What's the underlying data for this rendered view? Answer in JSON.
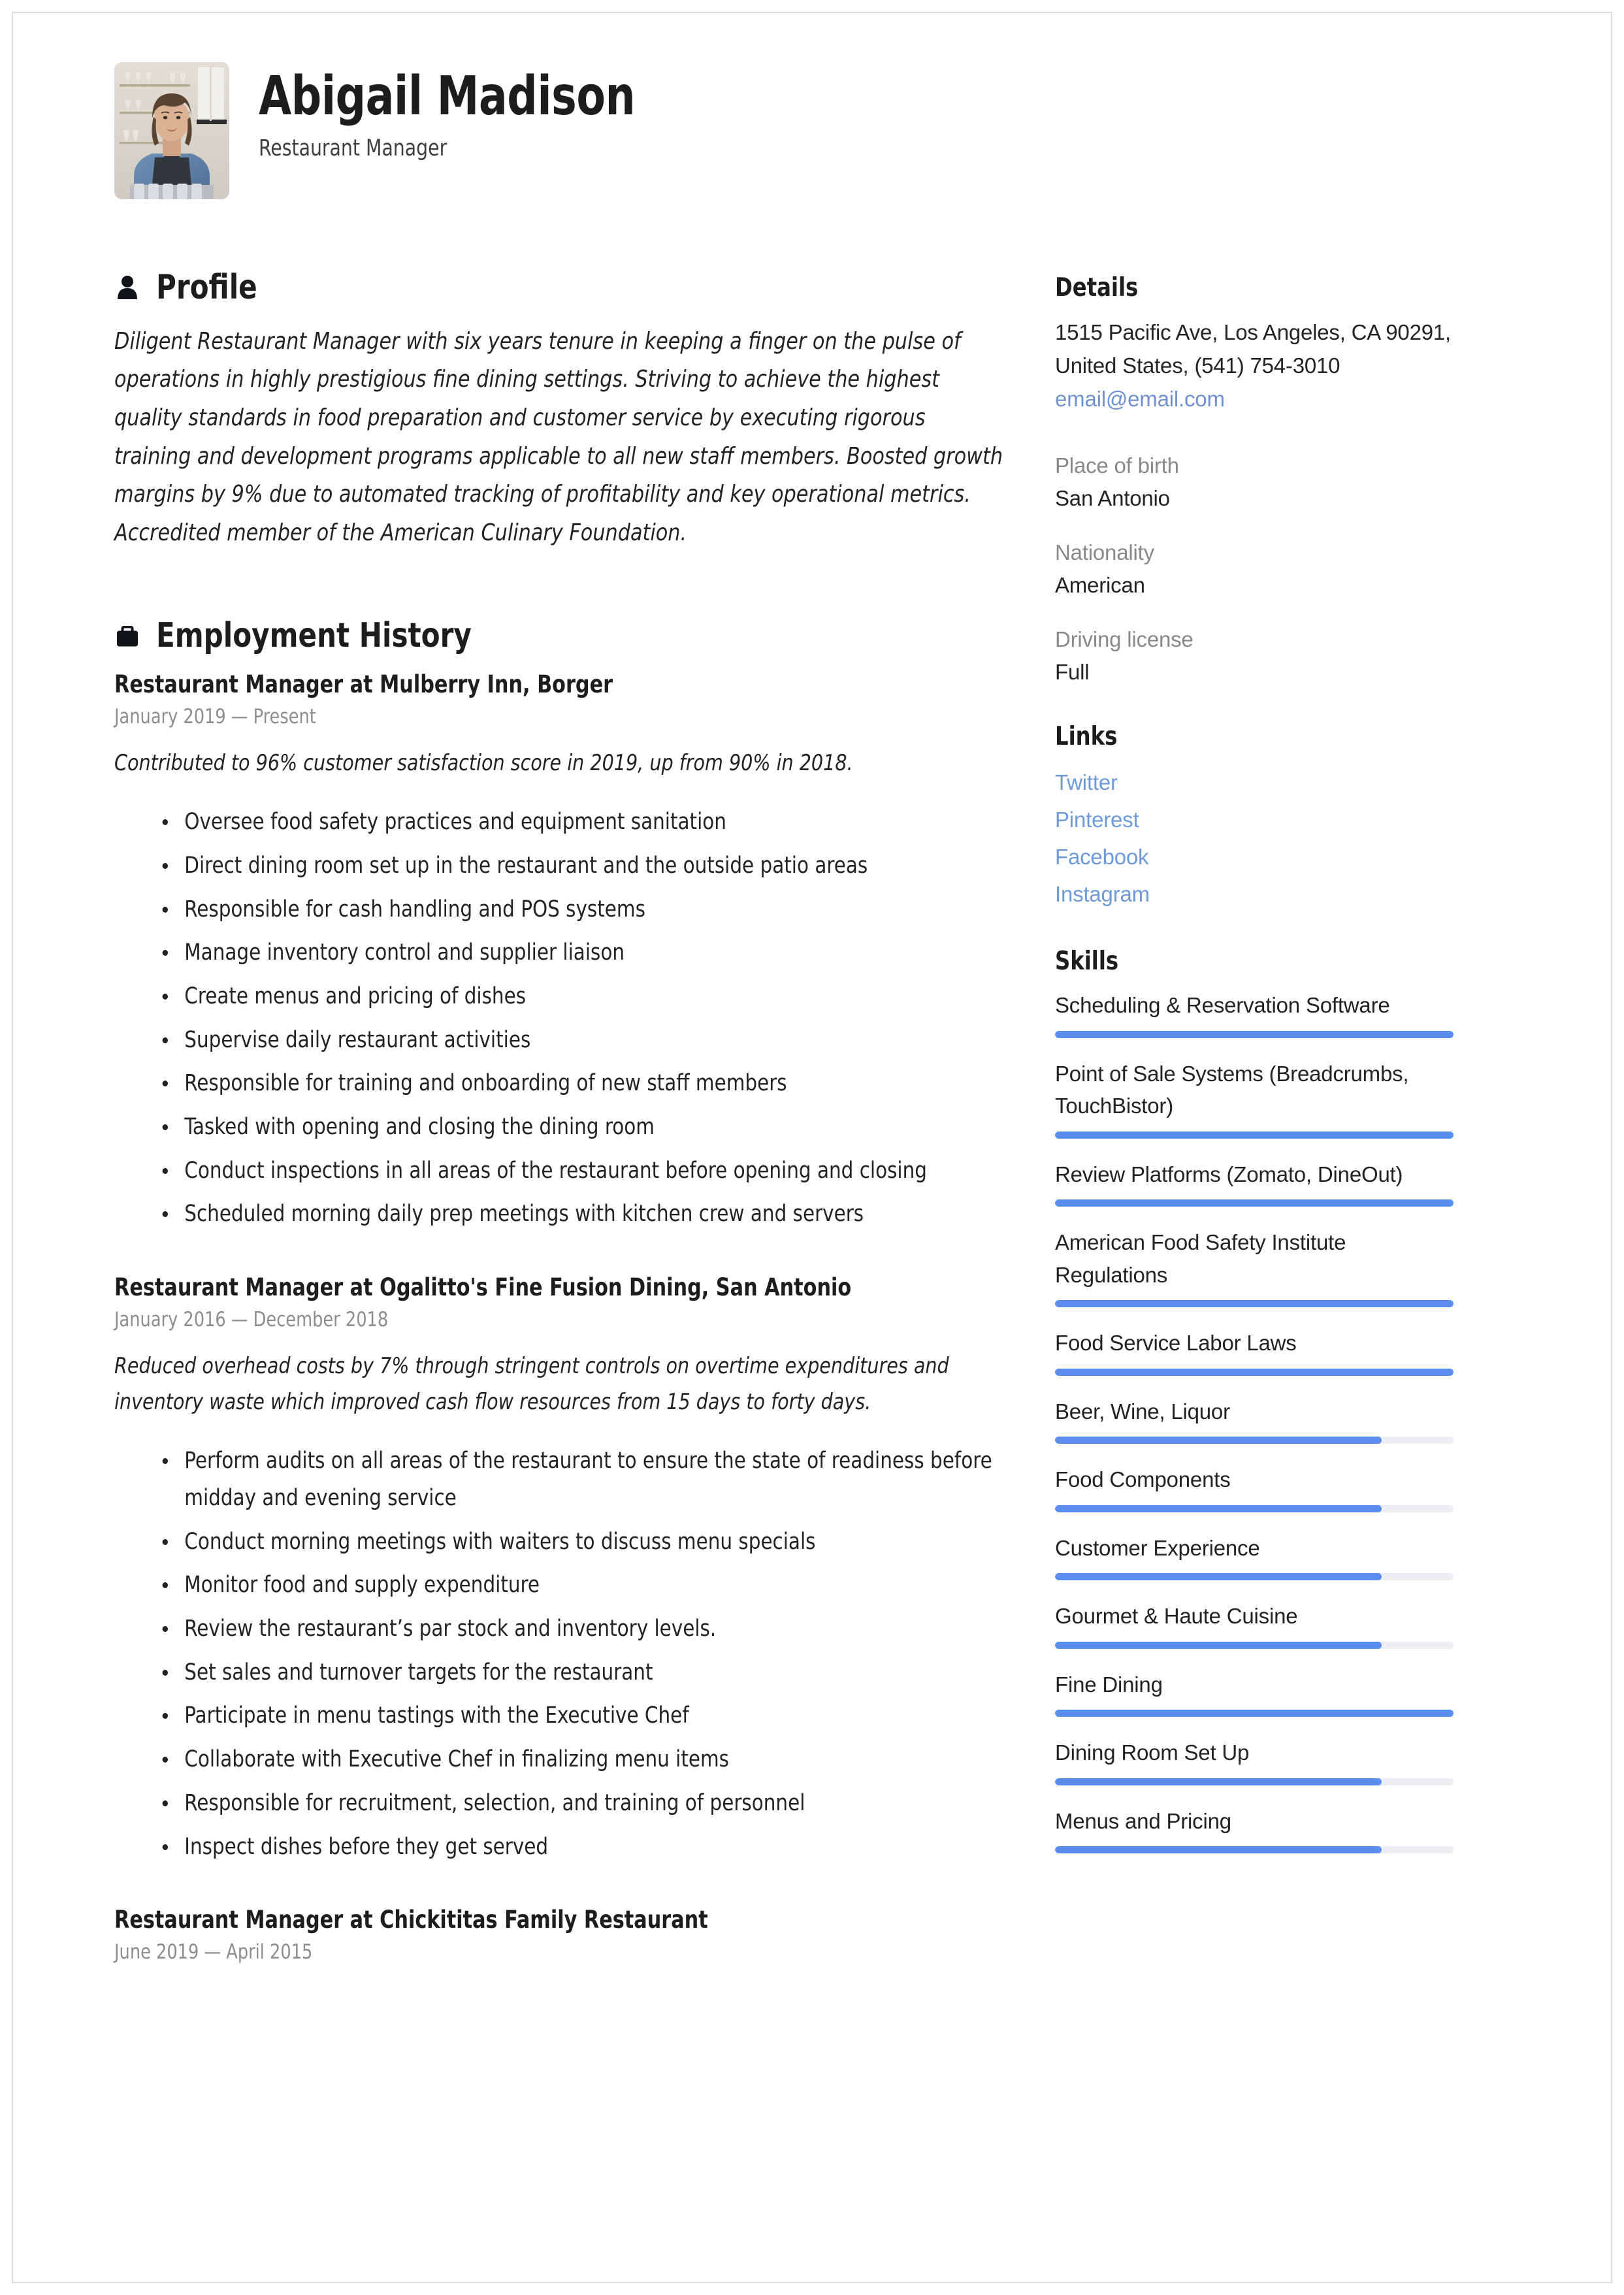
{
  "header": {
    "name": "Abigail Madison",
    "job_title": "Restaurant Manager",
    "photo_alt": "portrait-photo"
  },
  "sections": {
    "profile_title": "Profile",
    "profile_icon": "person-icon",
    "profile_text": "Diligent Restaurant Manager with six years tenure in keeping a finger on the pulse of operations in highly prestigious fine dining settings. Striving to achieve the highest quality standards in food preparation and customer service by executing rigorous training and development programs applicable to all new staff members. Boosted growth margins by 9% due to automated tracking of profitability and key operational metrics. Accredited member of the American Culinary Foundation.",
    "employment_title": "Employment History",
    "employment_icon": "briefcase-icon"
  },
  "jobs": [
    {
      "title": "Restaurant Manager at  Mulberry Inn, Borger",
      "date": "January 2019 — Present",
      "summary": "Contributed to 96% customer satisfaction score in 2019, up from 90% in 2018.",
      "bullets": [
        "Oversee food safety practices and equipment sanitation",
        "Direct dining room set up in the restaurant and the outside patio areas",
        "Responsible for cash handling and POS systems",
        "Manage inventory control and supplier liaison",
        "Create menus and pricing of dishes",
        "Supervise daily restaurant activities",
        "Responsible for training and onboarding of new staff members",
        "Tasked with opening and closing the dining room",
        "Conduct inspections in all areas of the restaurant before opening and closing",
        "Scheduled morning daily prep meetings with kitchen crew and servers"
      ]
    },
    {
      "title": "Restaurant Manager at  Ogalitto's Fine Fusion Dining, San Antonio",
      "date": "January 2016 — December 2018",
      "summary": "Reduced overhead costs by 7% through stringent controls on overtime expenditures and inventory waste which improved cash flow resources from 15 days to forty days.",
      "bullets": [
        "Perform audits on all areas of the restaurant to ensure the state of readiness before midday and evening service",
        "Conduct morning meetings with waiters to discuss menu specials",
        "Monitor food and supply expenditure",
        "Review the restaurant’s par stock and inventory levels.",
        "Set sales and turnover targets for the restaurant",
        "Participate in menu tastings with the Executive Chef",
        "Collaborate with Executive Chef in finalizing menu items",
        "Responsible for recruitment, selection, and training of personnel",
        "Inspect dishes before they get served"
      ]
    },
    {
      "title": "Restaurant Manager at  Chickititas Family Restaurant",
      "date": "June 2019 — April 2015",
      "summary": "",
      "bullets": []
    }
  ],
  "details": {
    "title": "Details",
    "address": "1515 Pacific Ave, Los Angeles, CA 90291, United States, (541) 754-3010",
    "email": "email@email.com",
    "fields": [
      {
        "label": "Place of birth",
        "value": "San Antonio"
      },
      {
        "label": "Nationality",
        "value": "American"
      },
      {
        "label": "Driving license",
        "value": "Full"
      }
    ]
  },
  "links": {
    "title": "Links",
    "items": [
      {
        "label": "Twitter"
      },
      {
        "label": "Pinterest"
      },
      {
        "label": "Facebook"
      },
      {
        "label": "Instagram"
      }
    ]
  },
  "skills": {
    "title": "Skills",
    "items": [
      {
        "name": "Scheduling & Reservation Software",
        "level": 100
      },
      {
        "name": "Point of Sale Systems (Breadcrumbs, TouchBistor)",
        "level": 100
      },
      {
        "name": "Review Platforms (Zomato, DineOut)",
        "level": 100
      },
      {
        "name": "American Food Safety Institute Regulations",
        "level": 100
      },
      {
        "name": "Food Service Labor Laws",
        "level": 100
      },
      {
        "name": "Beer, Wine, Liquor",
        "level": 82
      },
      {
        "name": "Food Components",
        "level": 82
      },
      {
        "name": "Customer Experience",
        "level": 82
      },
      {
        "name": "Gourmet & Haute Cuisine",
        "level": 82
      },
      {
        "name": "Fine Dining",
        "level": 100
      },
      {
        "name": "Dining Room Set Up",
        "level": 82
      },
      {
        "name": "Menus and Pricing",
        "level": 82
      }
    ]
  },
  "colors": {
    "accent": "#5b8def",
    "link": "#6f9ad8",
    "muted": "#88888d",
    "text": "#232326",
    "track": "#eceef1"
  }
}
